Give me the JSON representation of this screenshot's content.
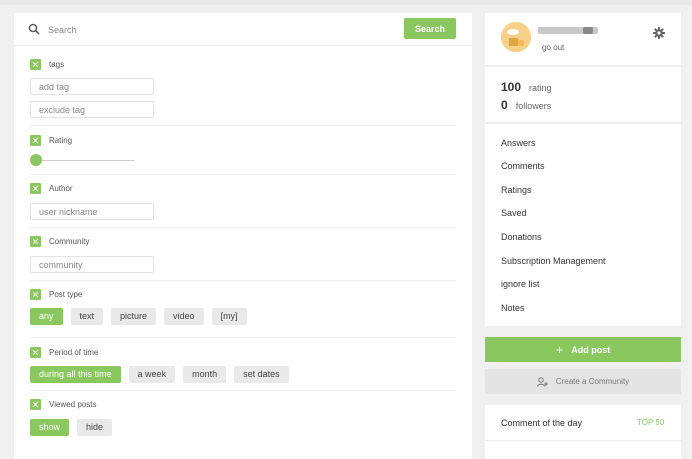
{
  "search": {
    "placeholder": "Search",
    "button_label": "Search"
  },
  "filters": {
    "tags": {
      "title": "tags",
      "add_placeholder": "add tag",
      "exclude_placeholder": "exclude tag"
    },
    "rating": {
      "title": "Rating",
      "slider_value": 0
    },
    "author": {
      "title": "Author",
      "placeholder": "user nickname"
    },
    "community": {
      "title": "Community",
      "placeholder": "community"
    },
    "post_type": {
      "title": "Post type",
      "options": [
        "any",
        "text",
        "picture",
        "video",
        "[my]"
      ],
      "selected": "any"
    },
    "period": {
      "title": "Period of time",
      "options": [
        "during all this time",
        "a week",
        "month",
        "set dates"
      ],
      "selected": "during all this time"
    },
    "viewed": {
      "title": "Viewed posts",
      "options": [
        "show",
        "hide"
      ],
      "selected": "show"
    }
  },
  "profile": {
    "go_out": "go out"
  },
  "stats": {
    "rating_value": "100",
    "rating_label": "rating",
    "followers_value": "0",
    "followers_label": "followers"
  },
  "menu": [
    "Answers",
    "Comments",
    "Ratings",
    "Saved",
    "Donations",
    "Subscription Management",
    "ignore list",
    "Notes"
  ],
  "actions": {
    "add_post": "Add post",
    "create_community": "Create a Community"
  },
  "comment_of_day": {
    "title": "Comment of the day",
    "top_link": "TOP 50"
  },
  "colors": {
    "accent": "#8ac85f",
    "background": "#f0f0f0"
  },
  "icons": [
    "search-icon",
    "gear-icon",
    "plus-icon",
    "add-user-icon",
    "checkbox-icon"
  ]
}
